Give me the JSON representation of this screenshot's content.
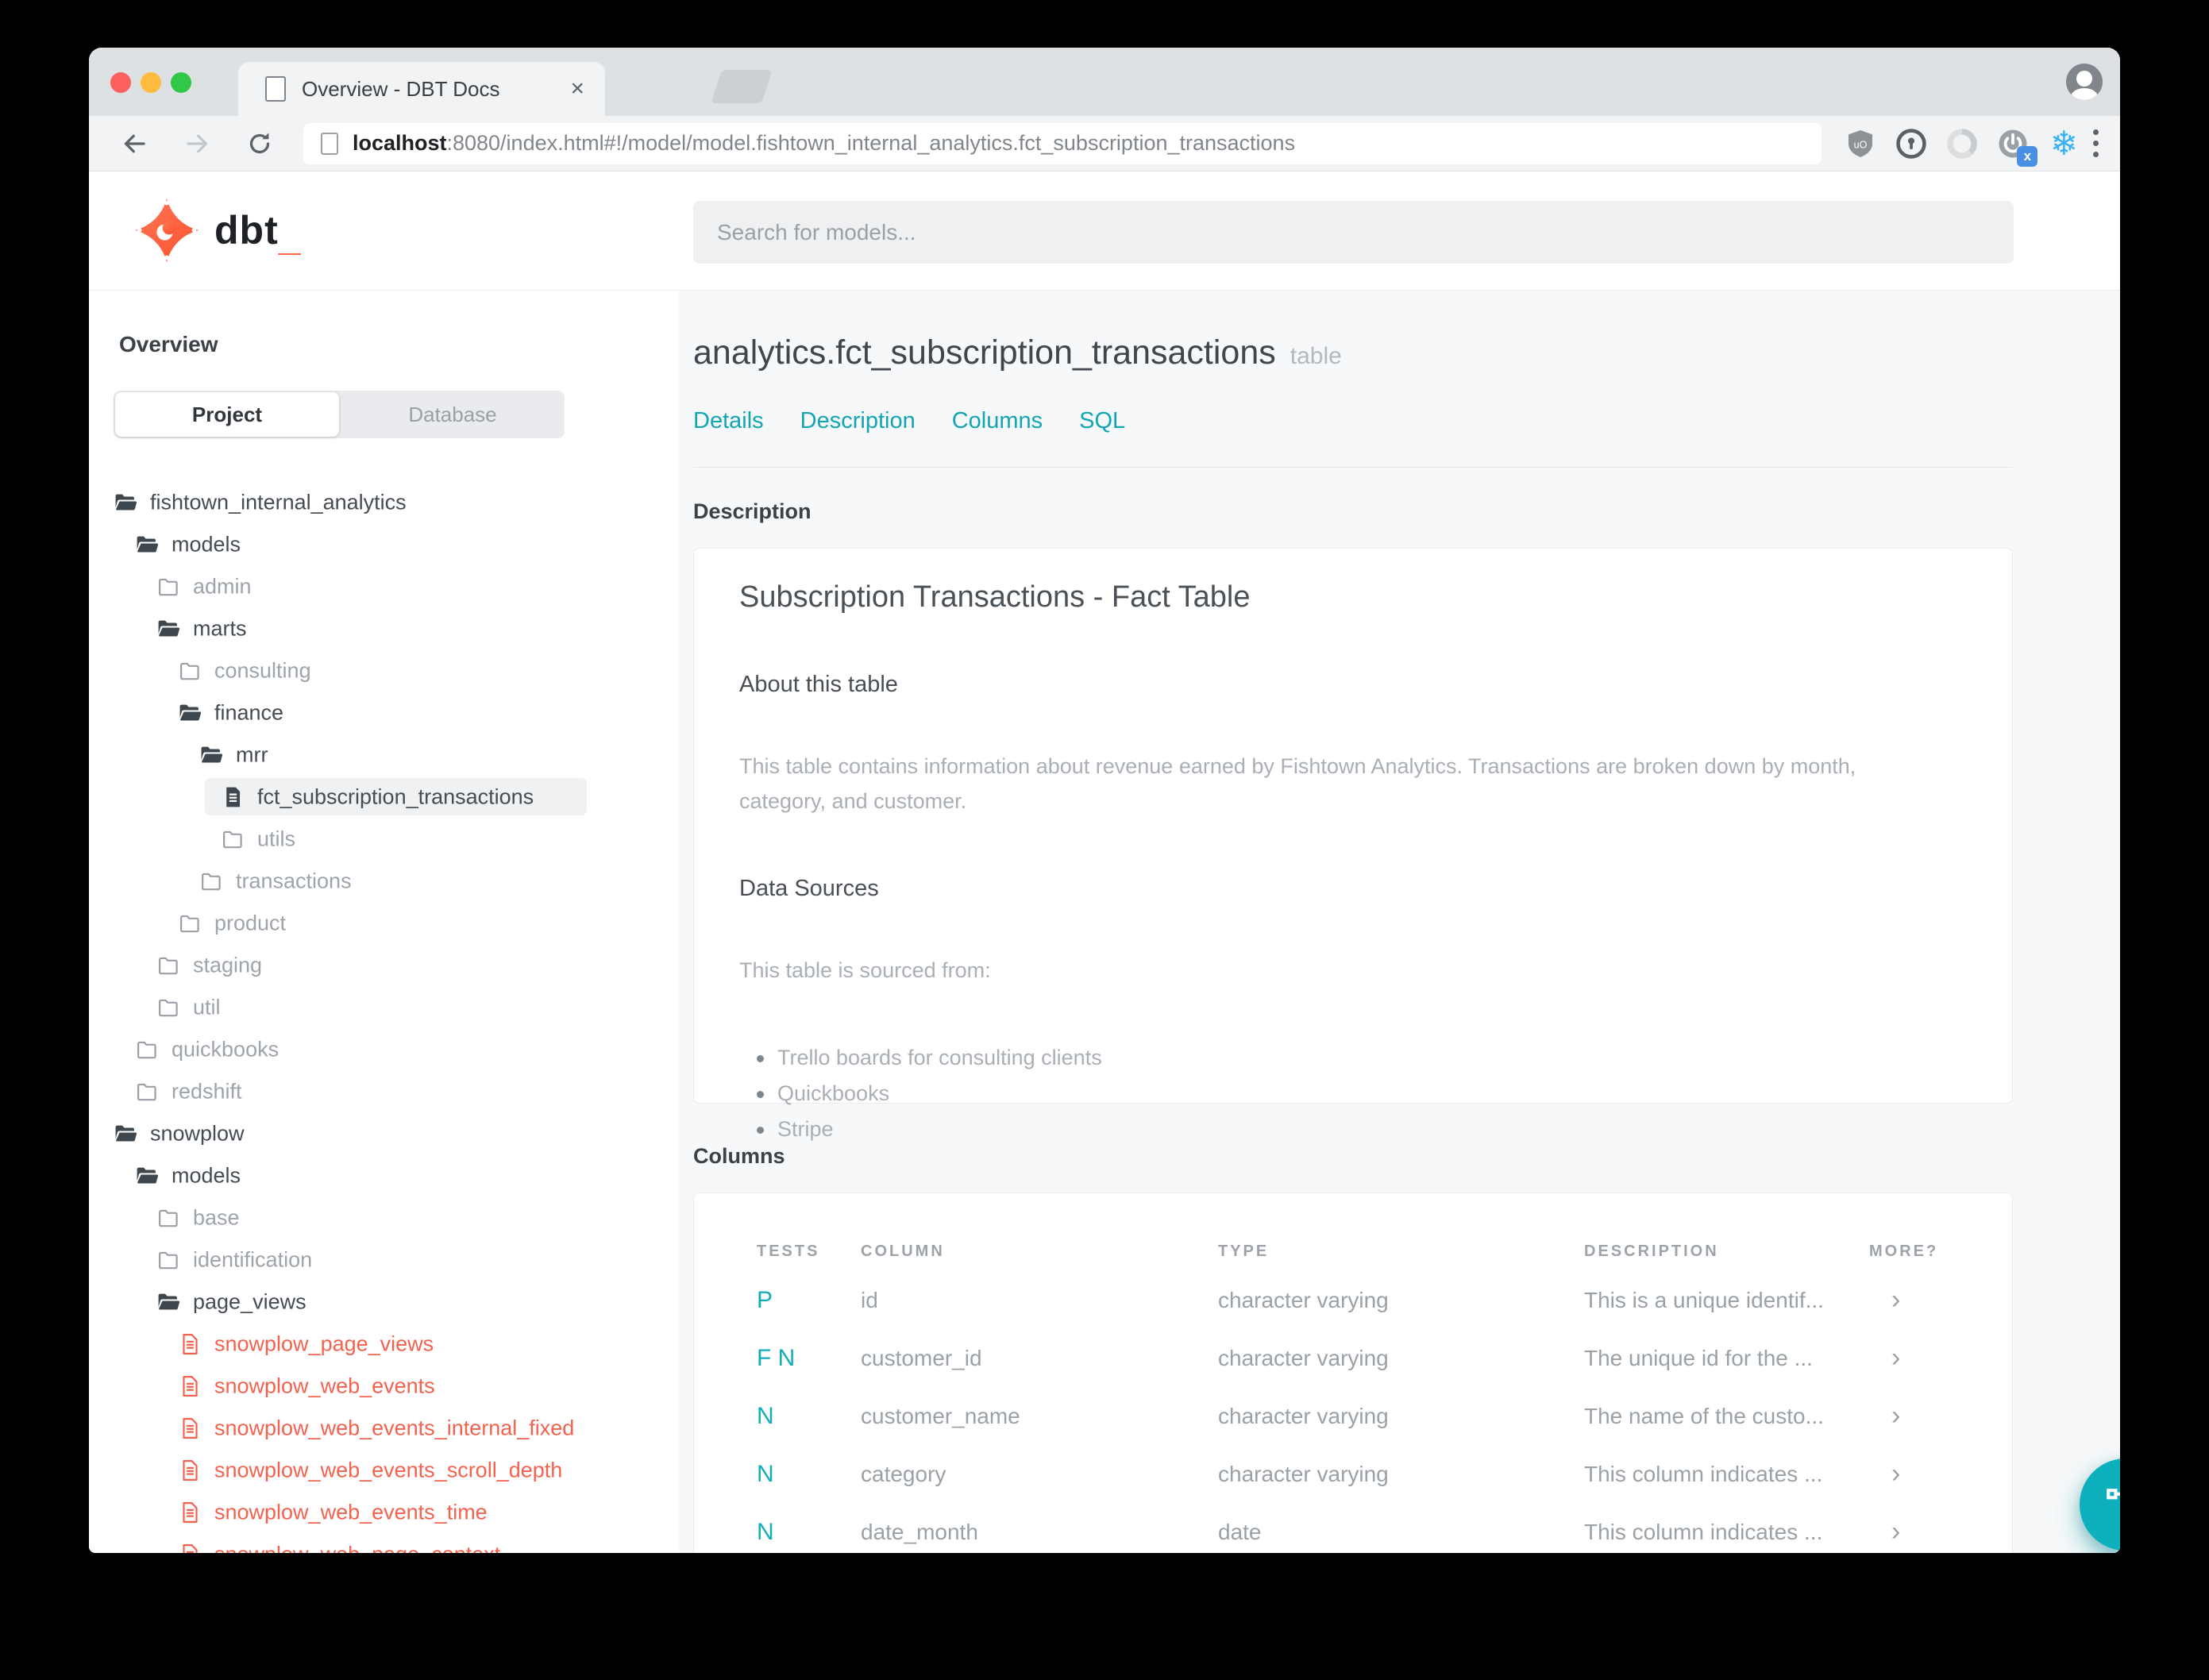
{
  "colors": {
    "accent_teal": "#13a5b4",
    "fab_teal": "#0db0bc",
    "brand_orange": "#ff5c35",
    "model_red": "#f4624f"
  },
  "browser": {
    "tab_title": "Overview - DBT Docs",
    "tab_close_glyph": "×",
    "url_host": "localhost",
    "url_rest": ":8080/index.html#!/model/model.fishtown_internal_analytics.fct_subscription_transactions",
    "snowflake_glyph": "❄"
  },
  "header": {
    "logo_text": "dbt",
    "logo_underscore": "_",
    "search_placeholder": "Search for models..."
  },
  "sidebar": {
    "title": "Overview",
    "tabs": [
      {
        "label": "Project",
        "active": true
      },
      {
        "label": "Database",
        "active": false
      }
    ],
    "tree": [
      {
        "label": "fishtown_internal_analytics",
        "level": 0,
        "icon": "folder-open",
        "tone": "dark"
      },
      {
        "label": "models",
        "level": 1,
        "icon": "folder-open",
        "tone": "dark"
      },
      {
        "label": "admin",
        "level": 2,
        "icon": "folder",
        "tone": "muted"
      },
      {
        "label": "marts",
        "level": 2,
        "icon": "folder-open",
        "tone": "dark"
      },
      {
        "label": "consulting",
        "level": 3,
        "icon": "folder",
        "tone": "muted"
      },
      {
        "label": "finance",
        "level": 3,
        "icon": "folder-open",
        "tone": "dark"
      },
      {
        "label": "mrr",
        "level": 4,
        "icon": "folder-open",
        "tone": "dark"
      },
      {
        "label": "fct_subscription_transactions",
        "level": 5,
        "icon": "file",
        "tone": "dark",
        "selected": true
      },
      {
        "label": "utils",
        "level": 5,
        "icon": "folder",
        "tone": "muted"
      },
      {
        "label": "transactions",
        "level": 4,
        "icon": "folder",
        "tone": "muted"
      },
      {
        "label": "product",
        "level": 3,
        "icon": "folder",
        "tone": "muted"
      },
      {
        "label": "staging",
        "level": 2,
        "icon": "folder",
        "tone": "muted"
      },
      {
        "label": "util",
        "level": 2,
        "icon": "folder",
        "tone": "muted"
      },
      {
        "label": "quickbooks",
        "level": 1,
        "icon": "folder",
        "tone": "muted"
      },
      {
        "label": "redshift",
        "level": 1,
        "icon": "folder",
        "tone": "muted"
      },
      {
        "label": "snowplow",
        "level": 0,
        "icon": "folder-open",
        "tone": "dark"
      },
      {
        "label": "models",
        "level": 1,
        "icon": "folder-open",
        "tone": "dark"
      },
      {
        "label": "base",
        "level": 2,
        "icon": "folder",
        "tone": "muted"
      },
      {
        "label": "identification",
        "level": 2,
        "icon": "folder",
        "tone": "muted"
      },
      {
        "label": "page_views",
        "level": 2,
        "icon": "folder-open",
        "tone": "dark"
      },
      {
        "label": "snowplow_page_views",
        "level": 3,
        "icon": "file",
        "tone": "red"
      },
      {
        "label": "snowplow_web_events",
        "level": 3,
        "icon": "file",
        "tone": "red"
      },
      {
        "label": "snowplow_web_events_internal_fixed",
        "level": 3,
        "icon": "file",
        "tone": "red"
      },
      {
        "label": "snowplow_web_events_scroll_depth",
        "level": 3,
        "icon": "file",
        "tone": "red"
      },
      {
        "label": "snowplow_web_events_time",
        "level": 3,
        "icon": "file",
        "tone": "red"
      },
      {
        "label": "snowplow_web_page_context",
        "level": 3,
        "icon": "file",
        "tone": "red"
      }
    ]
  },
  "main": {
    "title": "analytics.fct_subscription_transactions",
    "title_badge": "table",
    "nav_links": [
      "Details",
      "Description",
      "Columns",
      "SQL"
    ],
    "description_section": {
      "label": "Description",
      "heading": "Subscription Transactions - Fact Table",
      "about_heading": "About this table",
      "about_text": "This table contains information about revenue earned by Fishtown Analytics. Transactions are broken down by month, category, and customer.",
      "sources_heading": "Data Sources",
      "sources_intro": "This table is sourced from:",
      "sources": [
        "Trello boards for consulting clients",
        "Quickbooks",
        "Stripe"
      ]
    },
    "columns_section": {
      "label": "Columns",
      "headers": [
        "TESTS",
        "COLUMN",
        "TYPE",
        "DESCRIPTION",
        "MORE?"
      ],
      "rows": [
        {
          "tests": "P",
          "column": "id",
          "type": "character varying",
          "description": "This is a unique identif...",
          "more": "›"
        },
        {
          "tests": "F N",
          "column": "customer_id",
          "type": "character varying",
          "description": "The unique id for the ...",
          "more": "›"
        },
        {
          "tests": "N",
          "column": "customer_name",
          "type": "character varying",
          "description": "The name of the custo...",
          "more": "›"
        },
        {
          "tests": "N",
          "column": "category",
          "type": "character varying",
          "description": "This column indicates ...",
          "more": "›"
        },
        {
          "tests": "N",
          "column": "date_month",
          "type": "date",
          "description": "This column indicates ...",
          "more": "›"
        }
      ]
    }
  }
}
